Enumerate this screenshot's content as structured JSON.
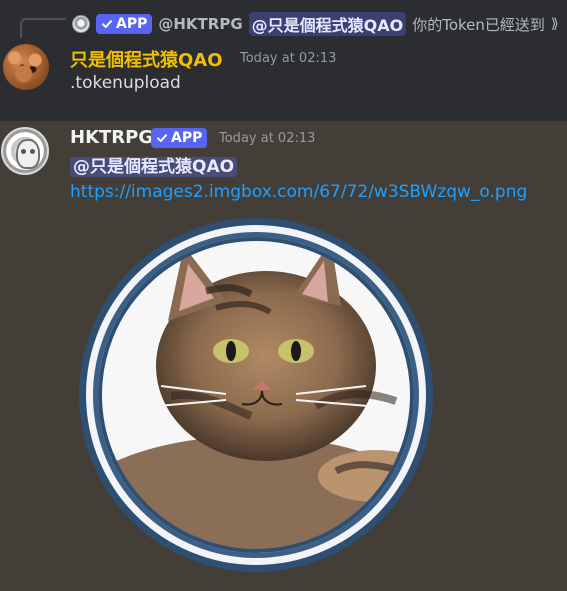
{
  "message1": {
    "reply": {
      "badge": "APP",
      "user": "@HKTRPG",
      "mention": "@只是個程式猿QAO",
      "text": "你的Token已經送到",
      "overflow_arrow": "⟫"
    },
    "username": "只是個程式猿QAO",
    "timestamp": "Today at 02:13",
    "content": ".tokenupload"
  },
  "message2": {
    "username": "HKTRPG",
    "badge": "APP",
    "timestamp": "Today at 02:13",
    "mention": "@只是個程式猿QAO",
    "link": "https://images2.imgbox.com/67/72/w3SBWzqw_o.png"
  },
  "colors": {
    "background_top": "#2b2d31",
    "background_bottom": "#433f38",
    "accent": "#5865f2",
    "link": "#1ea0ff",
    "username_gold": "#f0c000"
  },
  "icons": {
    "reply_avatar": "bot-avatar-icon",
    "verified": "check-icon"
  }
}
